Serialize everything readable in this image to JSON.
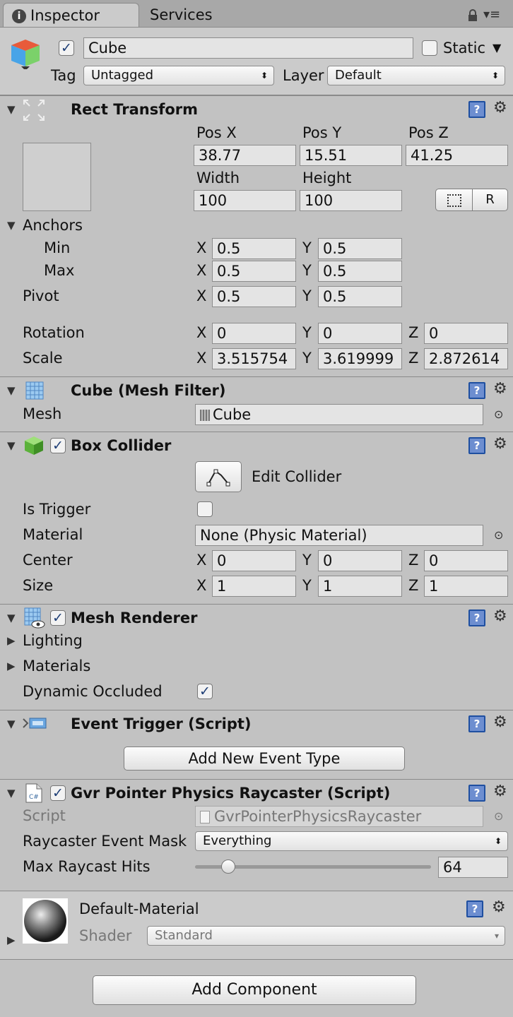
{
  "tabs": {
    "inspector": "Inspector",
    "services": "Services"
  },
  "object": {
    "name": "Cube",
    "active": true,
    "static_label": "Static",
    "static_checked": false,
    "tag_label": "Tag",
    "tag_value": "Untagged",
    "layer_label": "Layer",
    "layer_value": "Default"
  },
  "rect_transform": {
    "title": "Rect Transform",
    "pos_x_label": "Pos X",
    "pos_y_label": "Pos Y",
    "pos_z_label": "Pos Z",
    "pos_x": "38.77",
    "pos_y": "15.51",
    "pos_z": "41.25",
    "width_label": "Width",
    "height_label": "Height",
    "width": "100",
    "height": "100",
    "anchors_label": "Anchors",
    "min_label": "Min",
    "max_label": "Max",
    "anchor_min_x": "0.5",
    "anchor_min_y": "0.5",
    "anchor_max_x": "0.5",
    "anchor_max_y": "0.5",
    "pivot_label": "Pivot",
    "pivot_x": "0.5",
    "pivot_y": "0.5",
    "rotation_label": "Rotation",
    "rot_x": "0",
    "rot_y": "0",
    "rot_z": "0",
    "scale_label": "Scale",
    "scale_x": "3.515754",
    "scale_y": "3.619999",
    "scale_z": "2.872614",
    "raw_button": "R"
  },
  "axis": {
    "x": "X",
    "y": "Y",
    "z": "Z"
  },
  "mesh_filter": {
    "title": "Cube (Mesh Filter)",
    "mesh_label": "Mesh",
    "mesh_value": "Cube"
  },
  "box_collider": {
    "title": "Box Collider",
    "enabled": true,
    "edit_label": "Edit Collider",
    "is_trigger_label": "Is Trigger",
    "is_trigger": false,
    "material_label": "Material",
    "material_value": "None (Physic Material)",
    "center_label": "Center",
    "center_x": "0",
    "center_y": "0",
    "center_z": "0",
    "size_label": "Size",
    "size_x": "1",
    "size_y": "1",
    "size_z": "1"
  },
  "mesh_renderer": {
    "title": "Mesh Renderer",
    "enabled": true,
    "lighting_label": "Lighting",
    "materials_label": "Materials",
    "dynamic_occluded_label": "Dynamic Occluded",
    "dynamic_occluded": true
  },
  "event_trigger": {
    "title": "Event Trigger (Script)",
    "add_button": "Add New Event Type"
  },
  "raycaster": {
    "title": "Gvr Pointer Physics Raycaster (Script)",
    "enabled": true,
    "script_label": "Script",
    "script_value": "GvrPointerPhysicsRaycaster",
    "mask_label": "Raycaster Event Mask",
    "mask_value": "Everything",
    "max_hits_label": "Max Raycast Hits",
    "max_hits_value": "64",
    "max_hits_slider_fraction": 0.14
  },
  "material": {
    "name": "Default-Material",
    "shader_label": "Shader",
    "shader_value": "Standard"
  },
  "add_component": "Add Component",
  "icons": {
    "help": "help-icon",
    "settings": "gear-icon",
    "lock": "lock-icon",
    "menu": "menu-icon"
  },
  "colors": {
    "panel": "#c2c2c2",
    "check": "#1d3d75",
    "help": "#6d8ed0"
  }
}
